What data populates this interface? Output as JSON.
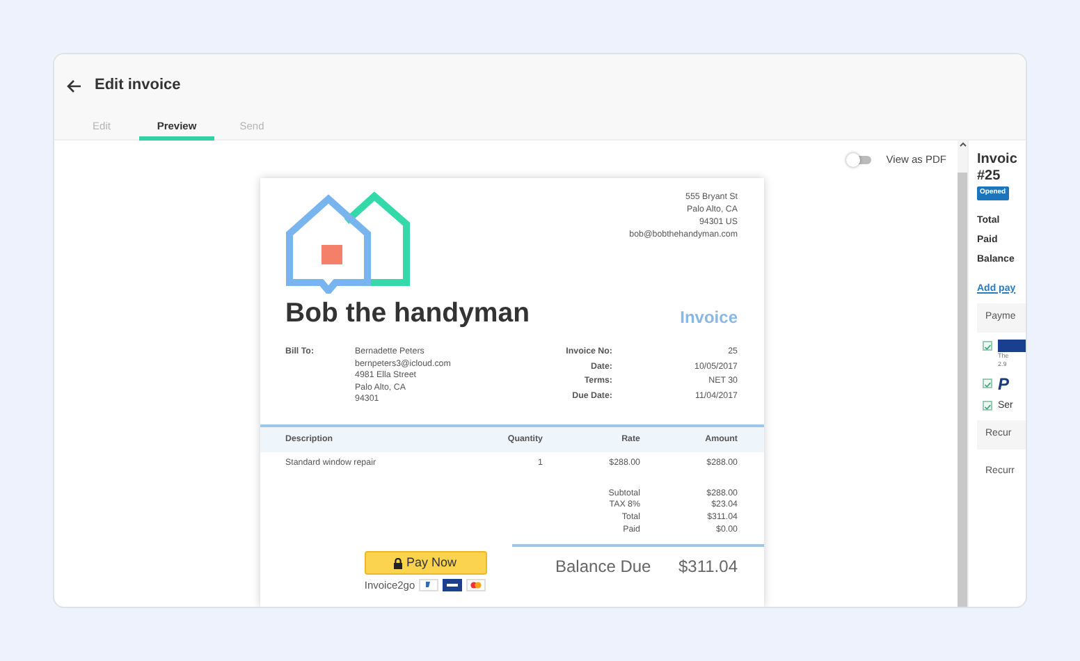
{
  "header": {
    "title": "Edit invoice"
  },
  "tabs": [
    {
      "label": "Edit",
      "selected": false
    },
    {
      "label": "Preview",
      "selected": true
    },
    {
      "label": "Send",
      "selected": false
    }
  ],
  "view_as_pdf": {
    "label": "View as PDF",
    "on": false
  },
  "invoice": {
    "sender_address": [
      "555 Bryant St",
      "Palo Alto, CA",
      "94301 US",
      "bob@bobthehandyman.com"
    ],
    "company_name": "Bob the handyman",
    "doc_title": "Invoice",
    "bill_to_label": "Bill To:",
    "bill_to": [
      "Bernadette Peters",
      "bernpeters3@icloud.com",
      "4981 Ella Street",
      "Palo Alto, CA",
      "94301"
    ],
    "meta": [
      {
        "label": "Invoice No:",
        "value": "25"
      },
      {
        "label": "Date:",
        "value": "10/05/2017"
      },
      {
        "label": "Terms:",
        "value": "NET 30"
      },
      {
        "label": "Due Date:",
        "value": "11/04/2017"
      }
    ],
    "columns": [
      "Description",
      "Quantity",
      "Rate",
      "Amount"
    ],
    "items": [
      {
        "description": "Standard window repair",
        "quantity": "1",
        "rate": "$288.00",
        "amount": "$288.00"
      }
    ],
    "totals": [
      {
        "label": "Subtotal",
        "value": "$288.00"
      },
      {
        "label": "TAX 8%",
        "value": "$23.04"
      },
      {
        "label": "Total",
        "value": "$311.04"
      },
      {
        "label": "Paid",
        "value": "$0.00"
      }
    ],
    "balance_label": "Balance Due",
    "balance_value": "$311.04",
    "pay_button": "Pay Now",
    "brand": "Invoice2go"
  },
  "side_panel": {
    "title": "Invoic",
    "number": "#25",
    "status": "Opened",
    "summary": [
      "Total",
      "Paid",
      "Balance"
    ],
    "add_payment": "Add pay",
    "payment_section": "Payme",
    "payment_options": [
      {
        "kind": "card",
        "checked": true,
        "note_lines": [
          "The",
          "2.9"
        ]
      },
      {
        "kind": "paypal",
        "checked": true,
        "label": "P"
      },
      {
        "kind": "text",
        "checked": true,
        "label": "Ser"
      }
    ],
    "recurring_section": "Recur",
    "recurring_label": "Recurr"
  }
}
